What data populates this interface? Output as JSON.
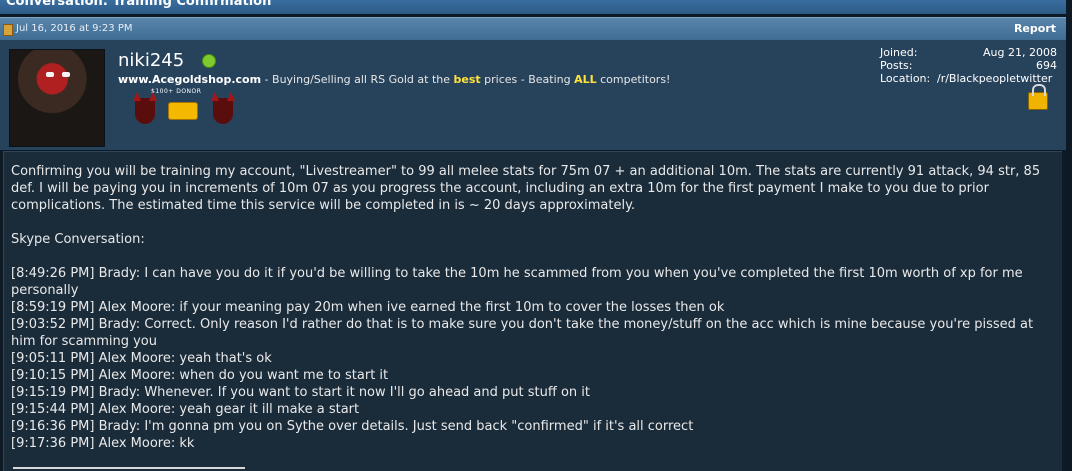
{
  "title": "Conversation: Training Confirmation",
  "post": {
    "date": "Jul 16, 2016 at 9:23 PM",
    "report_label": "Report"
  },
  "user": {
    "name": "niki245",
    "title_site": "www.Acegoldshop.com",
    "title_mid": " - Buying/Selling all RS Gold at the ",
    "title_best": "best",
    "title_mid2": " prices - Beating ",
    "title_all": "ALL",
    "title_end": " competitors!",
    "badge_caption": "$100+ DONOR",
    "stats": [
      {
        "key": "Joined:",
        "value": "Aug 21, 2008"
      },
      {
        "key": "Posts:",
        "value": "694"
      },
      {
        "key": "Location:",
        "value": "/r/Blackpeopletwitter"
      }
    ]
  },
  "message": {
    "intro": "Confirming you will be training my account, \"Livestreamer\" to 99 all melee stats for 75m 07 + an additional 10m. The stats are currently 91 attack, 94 str, 85 def. I will be paying you in increments of 10m 07 as you progress the account, including an extra 10m for the first payment I make to you due to prior complications. The estimated time this service will be completed in is ~ 20 days approximately.",
    "skype_heading": "Skype Conversation:",
    "lines": [
      "[8:49:26 PM] Brady: I can have you do it if you'd be willing to take the 10m he scammed from you when you've completed the first 10m worth of xp for me personally",
      "[8:59:19 PM] Alex Moore: if your meaning pay 20m when ive earned the first 10m to cover the losses then ok",
      "[9:03:52 PM] Brady: Correct. Only reason I'd rather do that is to make sure you don't take the money/stuff on the acc which is mine because you're pissed at him for scamming you",
      "[9:05:11 PM] Alex Moore: yeah that's ok",
      "[9:10:15 PM] Alex Moore: when do you want me to start it",
      "[9:15:19 PM] Brady: Whenever. If you want to start it now I'll go ahead and put stuff on it",
      "[9:15:44 PM] Alex Moore: yeah gear it ill make a start",
      "[9:16:36 PM] Brady: I'm gonna pm you on Sythe over details. Just send back \"confirmed\" if it's all correct",
      "[9:17:36 PM] Alex Moore: kk"
    ]
  }
}
